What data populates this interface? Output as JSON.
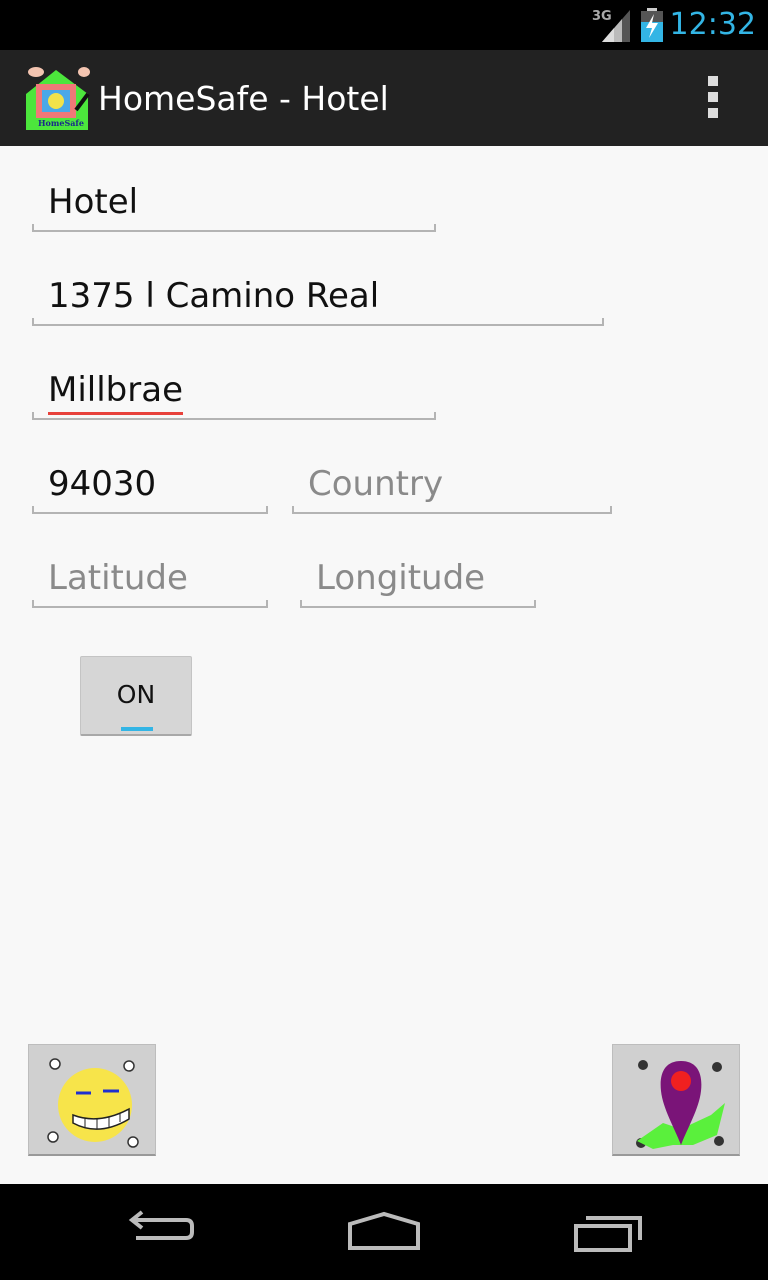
{
  "status_bar": {
    "network": "3G",
    "time": "12:32"
  },
  "action_bar": {
    "app_icon": "homesafe-app-icon",
    "icon_text": "HomeSafe",
    "title": "HomeSafe - Hotel",
    "overflow_icon": "overflow-menu-icon"
  },
  "form": {
    "name": {
      "value": "Hotel",
      "placeholder": ""
    },
    "street": {
      "value": "1375 l Camino Real",
      "placeholder": ""
    },
    "city": {
      "value": "Millbrae",
      "placeholder": ""
    },
    "zip": {
      "value": "94030",
      "placeholder": ""
    },
    "country": {
      "value": "",
      "placeholder": "Country"
    },
    "latitude": {
      "value": "",
      "placeholder": "Latitude"
    },
    "longitude": {
      "value": "",
      "placeholder": "Longitude"
    }
  },
  "toggle": {
    "label": "ON",
    "state": true,
    "accent": "#33b5e5"
  },
  "bottom_buttons": {
    "left_icon": "smiley-face-icon",
    "right_icon": "map-pin-icon"
  },
  "nav_bar": {
    "back_icon": "back-icon",
    "home_icon": "home-icon",
    "recents_icon": "recent-apps-icon"
  },
  "colors": {
    "status_time": "#33b5e5",
    "action_bar_bg": "#222222",
    "spellcheck_underline": "#e8413b"
  }
}
